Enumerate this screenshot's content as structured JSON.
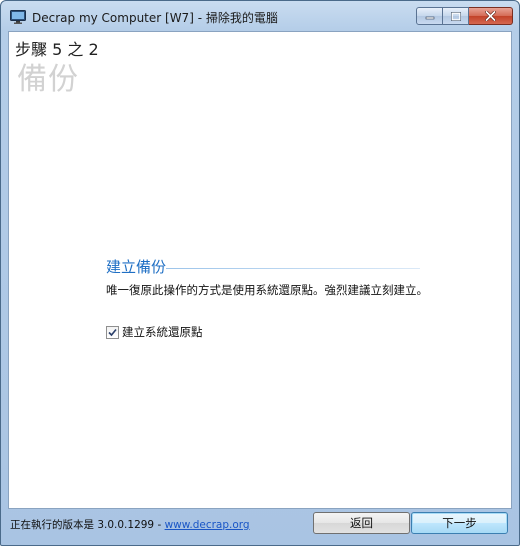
{
  "window": {
    "title": "Decrap my Computer [W7] - 掃除我的電腦",
    "icon": "monitor-icon"
  },
  "header": {
    "step": "步驟 5 之 2",
    "heading": "備份"
  },
  "section": {
    "title": "建立備份",
    "description": "唯一復原此操作的方式是使用系統還原點。強烈建議立刻建立。",
    "checkbox_label": "建立系統還原點",
    "checkbox_checked": true
  },
  "footer": {
    "version_prefix": "正在執行的版本是 3.0.0.1299 - ",
    "version_link": "www.decrap.org",
    "back_label": "返回",
    "next_label": "下一步"
  },
  "colors": {
    "accent": "#1f6fc4",
    "link": "#1a56c6",
    "close_button": "#c24128"
  }
}
